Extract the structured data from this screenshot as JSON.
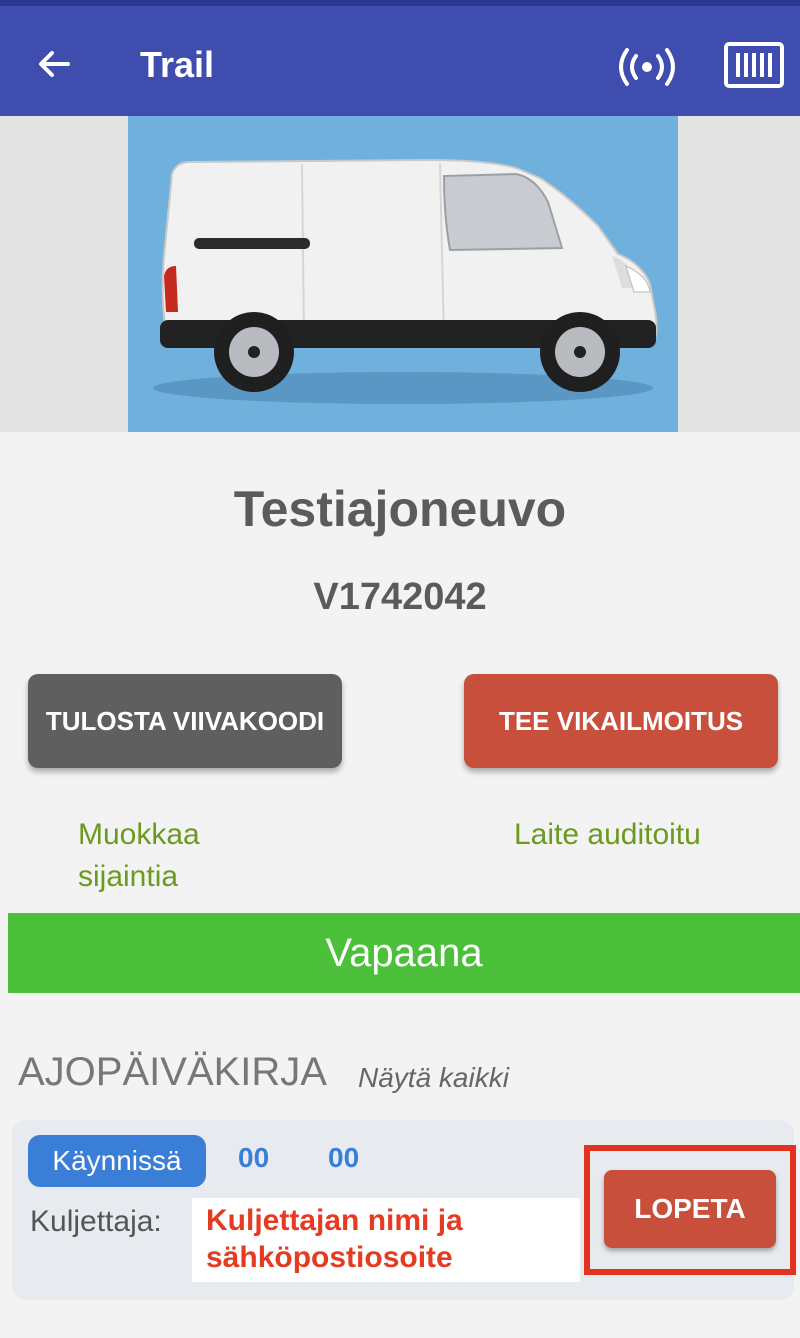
{
  "appbar": {
    "title": "Trail",
    "back_icon": "arrow-left-icon",
    "nfc_icon": "nfc-signal-icon",
    "barcode_icon": "barcode-scan-icon"
  },
  "vehicle": {
    "name": "Testiajoneuvo",
    "id": "V1742042"
  },
  "actions": {
    "print_barcode": "TULOSTA VIIVAKOODI",
    "fault_report": "TEE VIKAILMOITUS"
  },
  "links": {
    "edit_location": "Muokkaa sijaintia",
    "audited": "Laite auditoitu"
  },
  "status": {
    "label": "Vapaana",
    "color": "#4cbf3b"
  },
  "logbook": {
    "title": "AJOPÄIVÄKIRJA",
    "show_all": "Näytä kaikki",
    "entry": {
      "status_badge": "Käynnissä",
      "time_hours": "00",
      "time_minutes": "00",
      "driver_label": "Kuljettaja:",
      "driver_annotation": "Kuljettajan nimi ja sähköpostiosoite",
      "stop_button": "LOPETA"
    }
  },
  "colors": {
    "primary": "#3f4eae",
    "danger": "#c94f3d",
    "success": "#4cbf3b",
    "link": "#6a9a1f",
    "accent_blue": "#3a7ed8"
  }
}
